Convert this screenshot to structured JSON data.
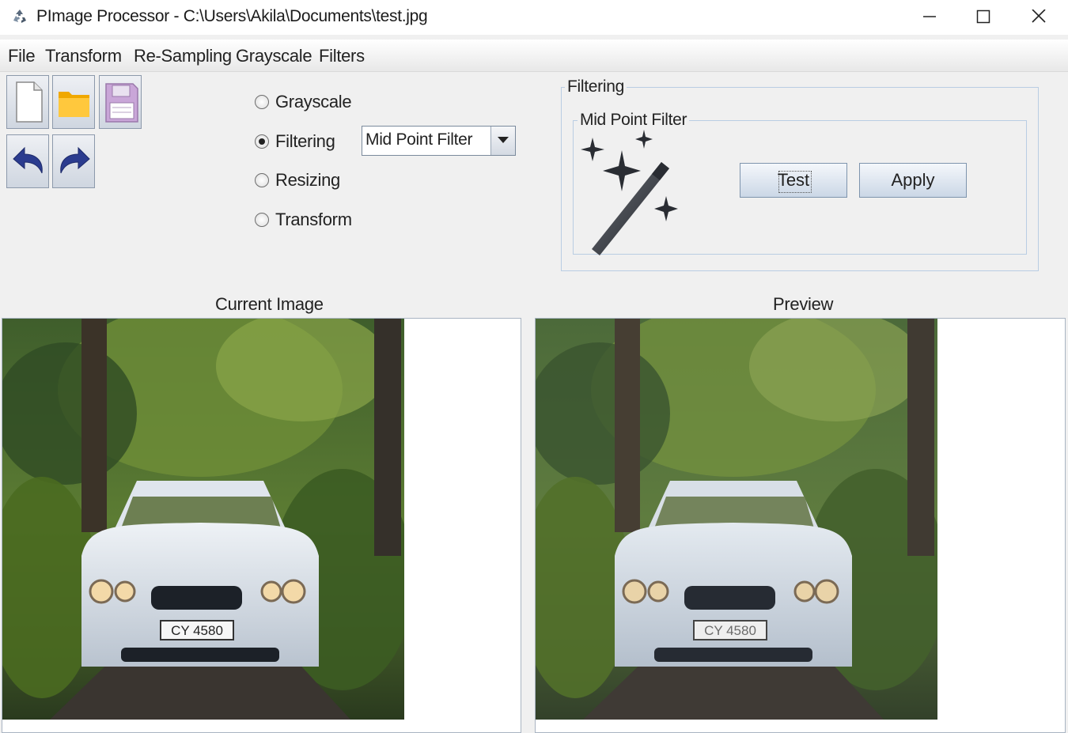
{
  "window": {
    "title": "PImage Processor - C:\\Users\\Akila\\Documents\\test.jpg",
    "icon": "recycle-app-icon"
  },
  "menu": [
    "File",
    "Transform",
    "Re-Sampling",
    "Grayscale",
    "Filters"
  ],
  "toolbar": {
    "buttons": [
      "new-file-icon",
      "open-folder-icon",
      "save-icon",
      "undo-icon",
      "redo-icon"
    ]
  },
  "options": {
    "radios": [
      {
        "label": "Grayscale",
        "selected": false
      },
      {
        "label": "Filtering",
        "selected": true
      },
      {
        "label": "Resizing",
        "selected": false
      },
      {
        "label": "Transform",
        "selected": false
      }
    ],
    "filter_select": "Mid Point Filter"
  },
  "filtering_panel": {
    "group_title": "Filtering",
    "sub_title": "Mid Point Filter",
    "icon": "magic-wand-icon",
    "test_label": "Test",
    "apply_label": "Apply"
  },
  "images": {
    "current_label": "Current Image",
    "preview_label": "Preview",
    "plate_text": "CY 4580",
    "preview_plate_text": "CY 4580"
  },
  "colors": {
    "button_gradient_top": "#f4f7fb",
    "button_gradient_bottom": "#cbd7e6",
    "group_border": "#b9cde3",
    "window_bg": "#f0f0f0"
  }
}
